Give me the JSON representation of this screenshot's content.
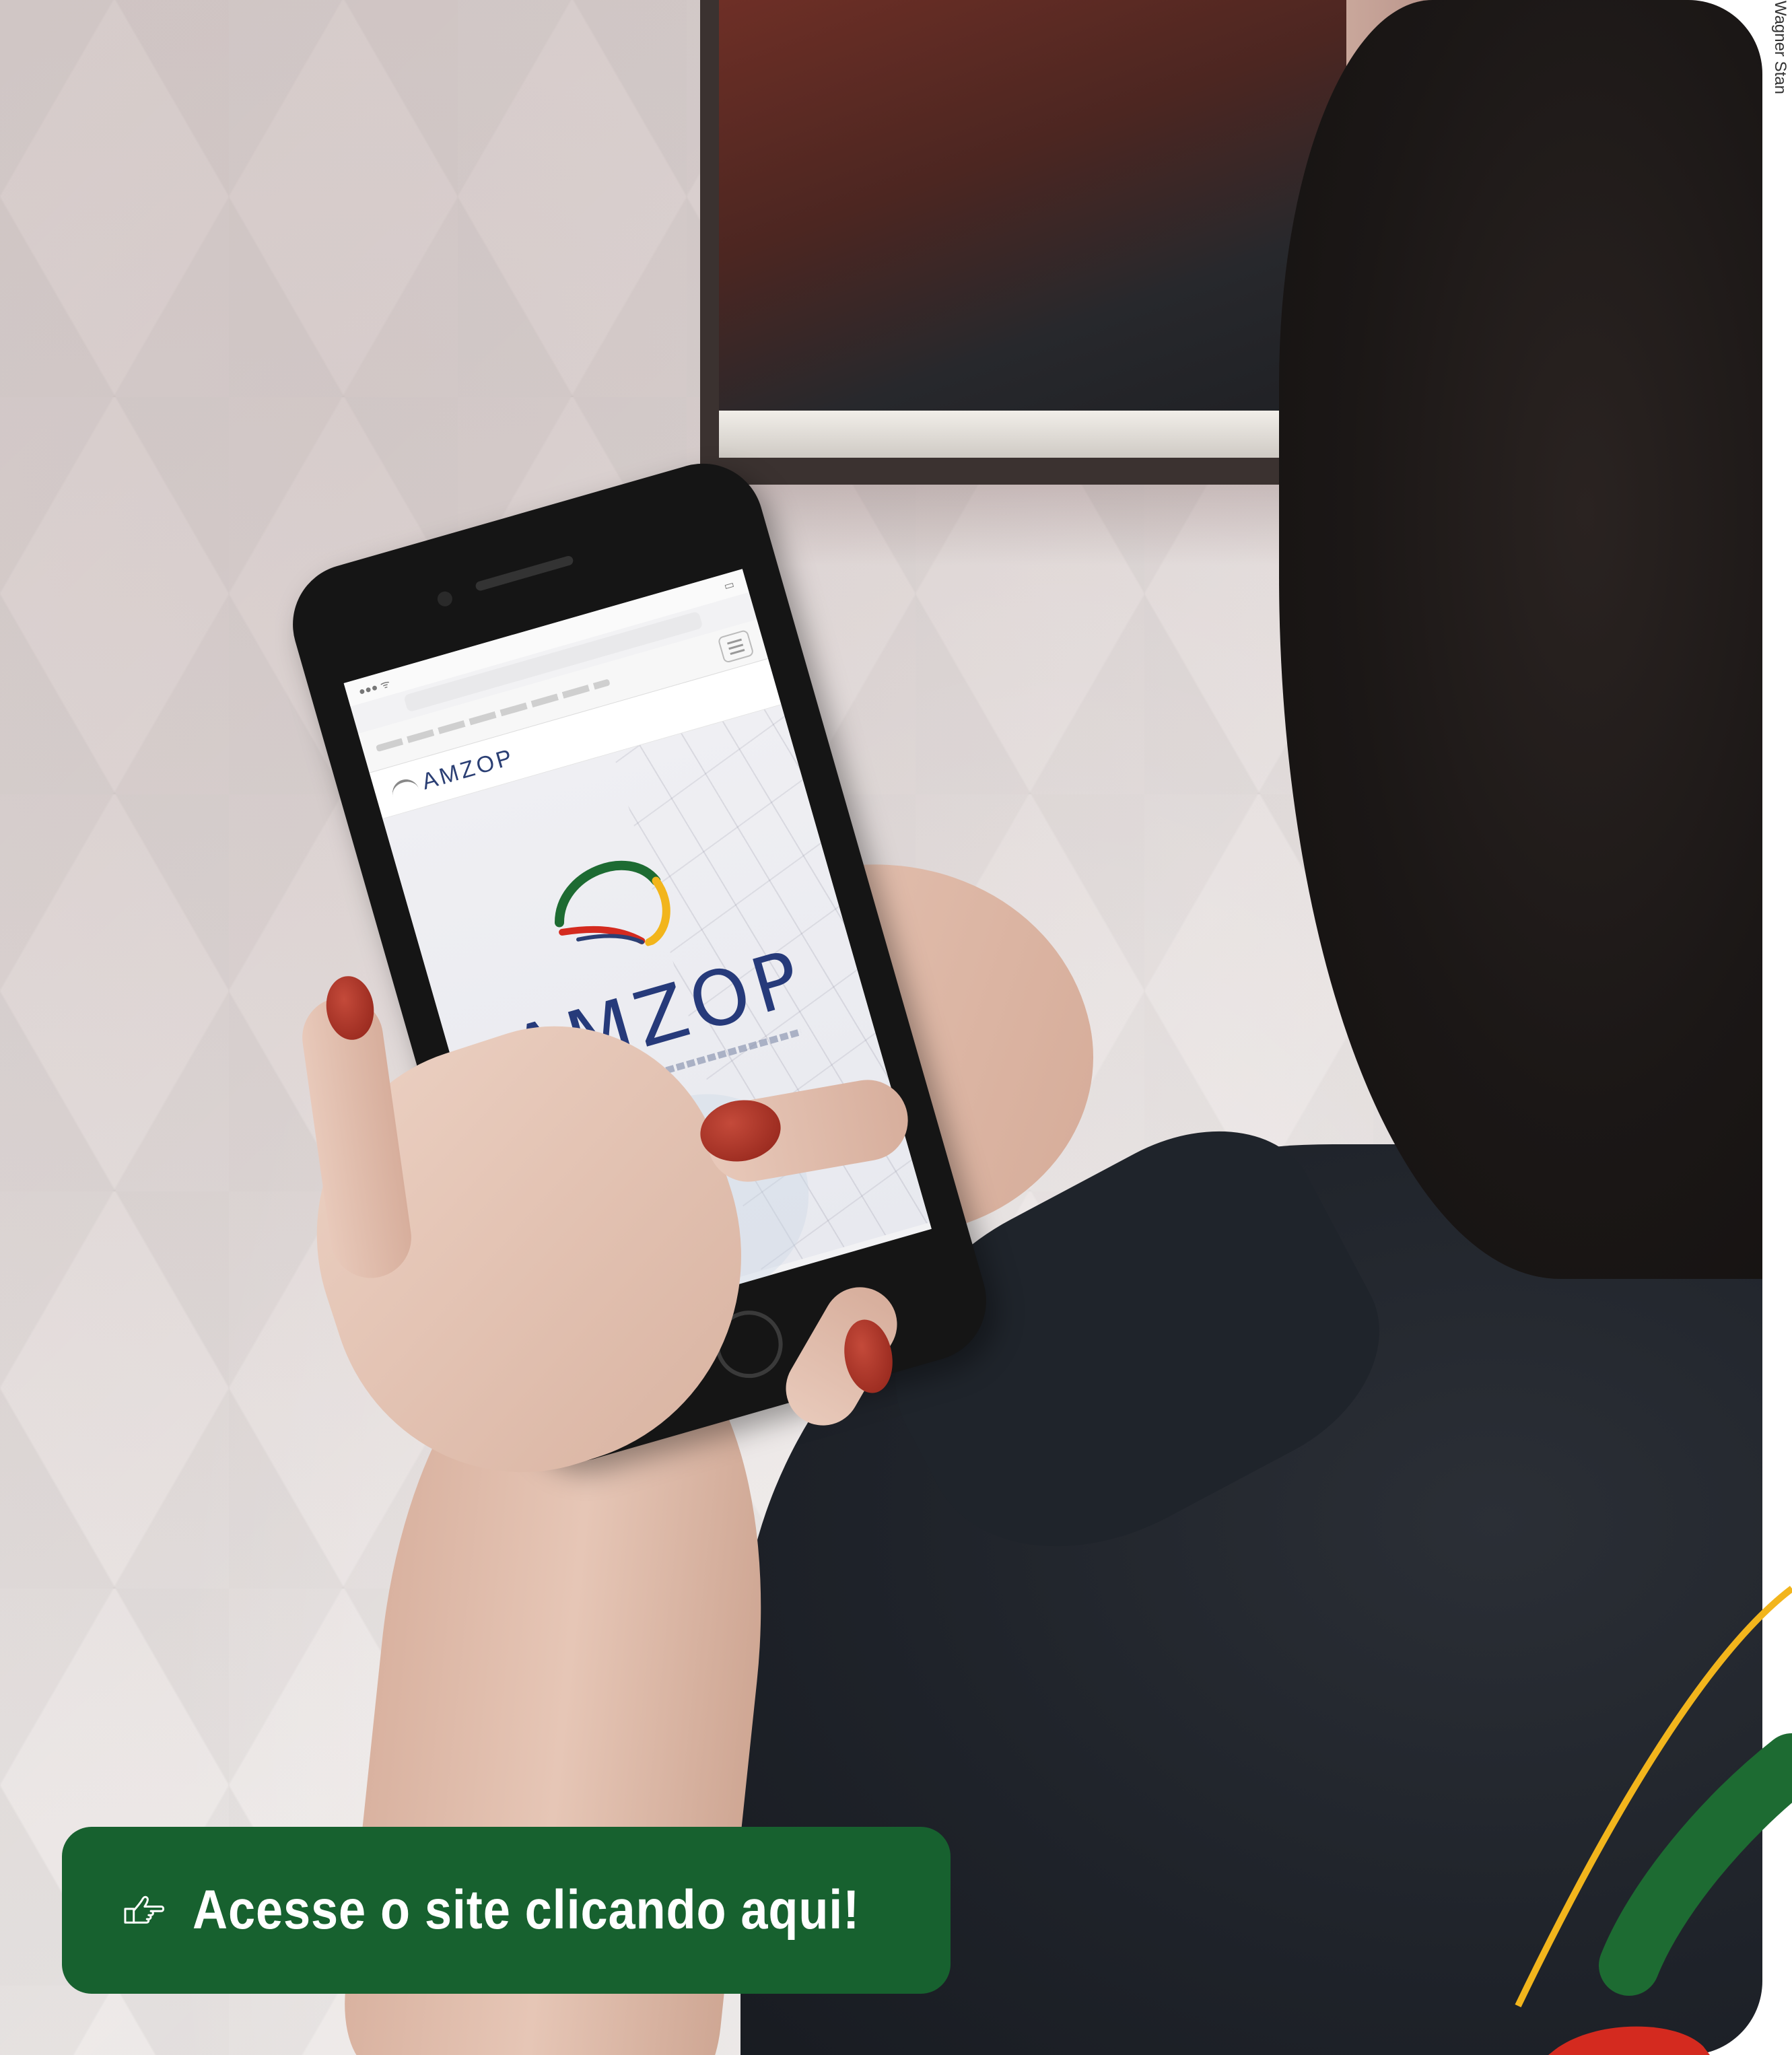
{
  "photo": {
    "credit": "Wagner Stan",
    "phone_screen": {
      "header_brand": "AMZOP",
      "hero_brand": "AMZOP"
    }
  },
  "cta": {
    "label": "Acesse o site clicando aqui!",
    "icon": "pointing-hand-icon",
    "background": "#17612f",
    "text_color": "#ffffff"
  },
  "brand_swoosh": {
    "colors": [
      "#f2b51c",
      "#1d6b32",
      "#d42a1f"
    ]
  }
}
